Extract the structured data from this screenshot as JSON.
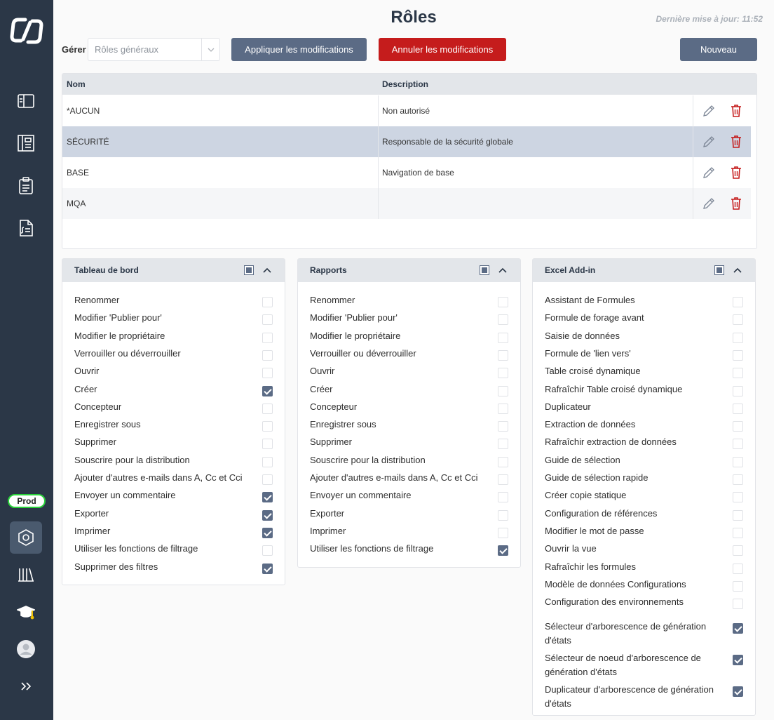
{
  "page": {
    "title": "Rôles",
    "last_update": "Dernière mise à jour: 11:52"
  },
  "toolbar": {
    "manage_label": "Gérer",
    "manage_value": "Rôles généraux",
    "apply_label": "Appliquer les modifications",
    "cancel_label": "Annuler les modifications",
    "new_label": "Nouveau"
  },
  "sidebar": {
    "env_badge": "Prod",
    "icons": [
      "logo-icon",
      "dashboard-icon",
      "reports-icon",
      "clipboard-icon",
      "document-formula-icon",
      "settings-hexagon-icon",
      "library-icon",
      "graduation-cap-icon",
      "user-avatar-icon",
      "expand-chevrons-icon"
    ]
  },
  "colors": {
    "sidebar": "#2b3747",
    "primary_button": "#5b6b85",
    "danger": "#c51c1c",
    "badge_border": "#2ad13a",
    "selected_row": "#cdd5e2"
  },
  "table": {
    "headers": [
      "Nom",
      "Description"
    ],
    "rows": [
      {
        "name": "*AUCUN",
        "description": "Non autorisé"
      },
      {
        "name": "SÉCURITÉ",
        "description": "Responsable de la sécurité globale"
      },
      {
        "name": "BASE",
        "description": "Navigation de base"
      },
      {
        "name": "MQA",
        "description": ""
      }
    ]
  },
  "panels": [
    {
      "title": "Tableau de bord",
      "items": [
        {
          "label": "Renommer",
          "checked": false
        },
        {
          "label": "Modifier 'Publier pour'",
          "checked": false
        },
        {
          "label": "Modifier le propriétaire",
          "checked": false
        },
        {
          "label": "Verrouiller ou déverrouiller",
          "checked": false
        },
        {
          "label": "Ouvrir",
          "checked": false
        },
        {
          "label": "Créer",
          "checked": true
        },
        {
          "label": "Concepteur",
          "checked": false
        },
        {
          "label": "Enregistrer sous",
          "checked": false
        },
        {
          "label": "Supprimer",
          "checked": false
        },
        {
          "label": "Souscrire pour la distribution",
          "checked": false
        },
        {
          "label": "Ajouter d'autres e-mails dans A, Cc et Cci",
          "checked": false
        },
        {
          "label": "Envoyer un commentaire",
          "checked": true
        },
        {
          "label": "Exporter",
          "checked": true
        },
        {
          "label": "Imprimer",
          "checked": true
        },
        {
          "label": "Utiliser les fonctions de filtrage",
          "checked": false
        },
        {
          "label": "Supprimer des filtres",
          "checked": true
        }
      ]
    },
    {
      "title": "Rapports",
      "items": [
        {
          "label": "Renommer",
          "checked": false
        },
        {
          "label": "Modifier 'Publier pour'",
          "checked": false
        },
        {
          "label": "Modifier le propriétaire",
          "checked": false
        },
        {
          "label": "Verrouiller ou déverrouiller",
          "checked": false
        },
        {
          "label": "Ouvrir",
          "checked": false
        },
        {
          "label": "Créer",
          "checked": false
        },
        {
          "label": "Concepteur",
          "checked": false
        },
        {
          "label": "Enregistrer sous",
          "checked": false
        },
        {
          "label": "Supprimer",
          "checked": false
        },
        {
          "label": "Souscrire pour la distribution",
          "checked": false
        },
        {
          "label": "Ajouter d'autres e-mails dans A, Cc et Cci",
          "checked": false
        },
        {
          "label": "Envoyer un commentaire",
          "checked": false
        },
        {
          "label": "Exporter",
          "checked": false
        },
        {
          "label": "Imprimer",
          "checked": false
        },
        {
          "label": "Utiliser les fonctions de filtrage",
          "checked": true
        }
      ]
    },
    {
      "title": "Excel Add-in",
      "items": [
        {
          "label": "Assistant de Formules",
          "checked": false
        },
        {
          "label": "Formule de forage avant",
          "checked": false
        },
        {
          "label": "Saisie de données",
          "checked": false
        },
        {
          "label": "Formule de 'lien vers'",
          "checked": false
        },
        {
          "label": "Table croisé dynamique",
          "checked": false
        },
        {
          "label": "Rafraîchir Table croisé dynamique",
          "checked": false
        },
        {
          "label": "Duplicateur",
          "checked": false
        },
        {
          "label": "Extraction de données",
          "checked": false
        },
        {
          "label": "Rafraîchir extraction de données",
          "checked": false
        },
        {
          "label": "Guide de sélection",
          "checked": false
        },
        {
          "label": "Guide de sélection rapide",
          "checked": false
        },
        {
          "label": "Créer copie statique",
          "checked": false
        },
        {
          "label": "Configuration de références",
          "checked": false
        },
        {
          "label": "Modifier le mot de passe",
          "checked": false
        },
        {
          "label": "Ouvrir la vue",
          "checked": false
        },
        {
          "label": "Rafraîchir les formules",
          "checked": false
        },
        {
          "label": "Modèle de données Configurations",
          "checked": false
        },
        {
          "label": "Configuration des environnements",
          "checked": false
        },
        {
          "label": "Sélecteur d'arborescence de génération d'états",
          "checked": true
        },
        {
          "label": "Sélecteur de noeud d'arborescence de génération d'états",
          "checked": true
        },
        {
          "label": "Duplicateur d'arborescence de génération d'états",
          "checked": true
        }
      ]
    }
  ]
}
